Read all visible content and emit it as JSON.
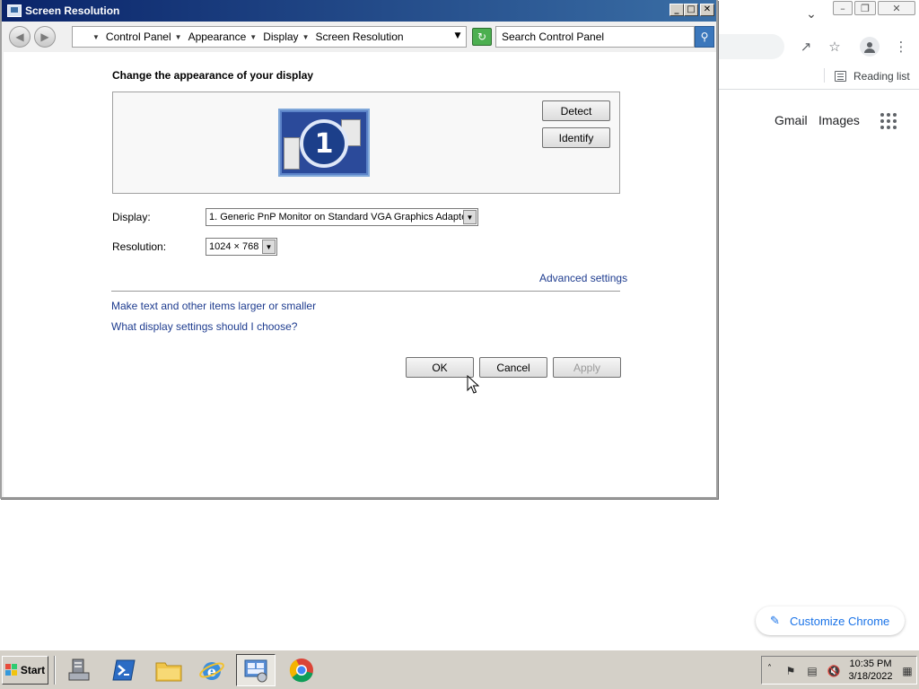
{
  "dialog": {
    "title": "Screen Resolution",
    "breadcrumb": [
      "Control Panel",
      "Appearance",
      "Display",
      "Screen Resolution"
    ],
    "search_placeholder": "Search Control Panel",
    "heading": "Change the appearance of your display",
    "monitor_number": "1",
    "detect_label": "Detect",
    "identify_label": "Identify",
    "display_label": "Display:",
    "display_value": "1. Generic PnP Monitor on Standard VGA Graphics Adapter",
    "resolution_label": "Resolution:",
    "resolution_value": "1024 × 768",
    "advanced_link": "Advanced settings",
    "larger_link": "Make text and other items larger or smaller",
    "choose_link": "What display settings should I choose?",
    "ok_label": "OK",
    "cancel_label": "Cancel",
    "apply_label": "Apply"
  },
  "chrome": {
    "reading_list": "Reading list",
    "gmail": "Gmail",
    "images": "Images",
    "customize": "Customize Chrome"
  },
  "taskbar": {
    "start_label": "Start",
    "apps": [
      "server-manager-icon",
      "powershell-icon",
      "file-explorer-icon",
      "internet-explorer-icon",
      "control-panel-icon",
      "chrome-icon"
    ],
    "clock_time": "10:35 PM",
    "clock_date": "3/18/2022"
  },
  "colors": {
    "title_bar": "#0a246a",
    "link": "#1e3c8f",
    "chrome_accent": "#1a73e8",
    "taskbar": "#d4d0c8"
  }
}
